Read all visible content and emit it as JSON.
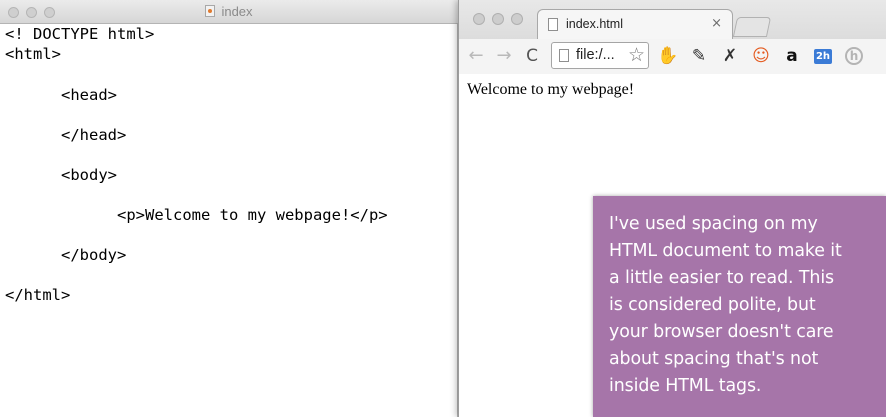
{
  "editor": {
    "title": "index",
    "code_lines": [
      "<! DOCTYPE html>",
      "<html>",
      "<head>",
      "</head>",
      "<body>",
      "<p>Welcome to my webpage!</p>",
      "</body>",
      "</html>"
    ]
  },
  "browser": {
    "tab": {
      "title": "index.html",
      "close": "×"
    },
    "nav": {
      "back": "←",
      "forward": "→",
      "reload": "C"
    },
    "address": {
      "value": "file:/...",
      "star": "☆"
    },
    "extensions": [
      {
        "name": "adblock-icon",
        "glyph": "✋",
        "color": "#9a9a9a"
      },
      {
        "name": "brush-icon",
        "glyph": "✎",
        "color": "#333333"
      },
      {
        "name": "plug-icon",
        "glyph": "✗",
        "color": "#333333"
      },
      {
        "name": "hola-icon",
        "glyph": "☺",
        "color": "#e45a1f"
      },
      {
        "name": "amazon-icon",
        "glyph": "a",
        "color": "#111111"
      },
      {
        "name": "calendar-icon",
        "glyph": "2h",
        "color": "#3b7bd6"
      },
      {
        "name": "h-icon",
        "glyph": "h",
        "color": "#b4b4b4"
      }
    ],
    "page_text": "Welcome to my webpage!"
  },
  "note": {
    "text": "I've used spacing on my\nHTML document to make it\na little easier to read. This\nis considered polite, but\nyour browser doesn't care\nabout spacing that's not\ninside HTML tags.",
    "background": "#a675a9"
  }
}
